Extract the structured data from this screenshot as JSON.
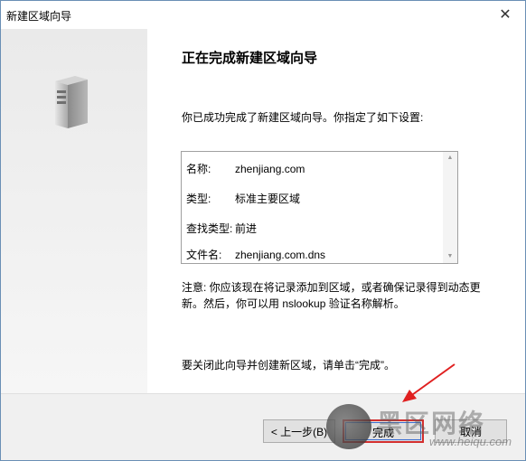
{
  "window": {
    "title": "新建区域向导",
    "close_glyph": "✕"
  },
  "content": {
    "heading": "正在完成新建区域向导",
    "intro": "你已成功完成了新建区域向导。你指定了如下设置:",
    "summary": [
      {
        "label": "名称:",
        "value": "zhenjiang.com"
      },
      {
        "label": "类型:",
        "value": "标准主要区域"
      },
      {
        "label": "查找类型:",
        "value": "前进"
      },
      {
        "label": "文件名:",
        "value": "zhenjiang.com.dns"
      }
    ],
    "note": "注意: 你应该现在将记录添加到区域，或者确保记录得到动态更新。然后，你可以用 nslookup 验证名称解析。",
    "close_hint": "要关闭此向导并创建新区域，请单击“完成”。"
  },
  "buttons": {
    "back": "< 上一步(B)",
    "finish": "完成",
    "cancel": "取消"
  },
  "watermark": {
    "text": "黑区网络",
    "url": "www.heiqu.com"
  },
  "colors": {
    "highlight_red": "#d32f2f",
    "focus_blue": "#3c6fd1"
  },
  "icons": {
    "side": "server-icon",
    "arrow": "red-arrow-annotation"
  }
}
